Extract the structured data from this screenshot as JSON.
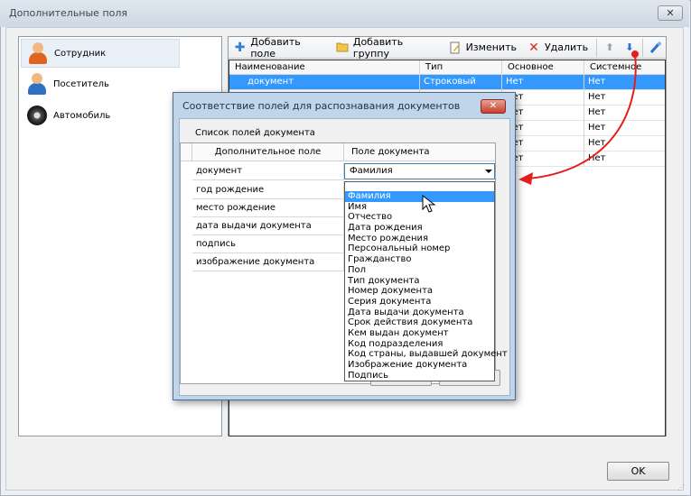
{
  "window": {
    "title": "Дополнительные поля",
    "close_glyph": "✕"
  },
  "left_panel": {
    "items": [
      {
        "label": "Сотрудник",
        "icon": "employee-icon",
        "selected": true
      },
      {
        "label": "Посетитель",
        "icon": "visitor-icon",
        "selected": false
      },
      {
        "label": "Автомобиль",
        "icon": "car-wheel-icon",
        "selected": false
      }
    ]
  },
  "toolbar": {
    "add_field": "Добавить поле",
    "add_group": "Добавить группу",
    "edit": "Изменить",
    "delete": "Удалить"
  },
  "grid": {
    "columns": [
      "Наименование",
      "Тип",
      "Основное",
      "Системное"
    ],
    "rows": [
      [
        "документ",
        "Строковый",
        "Нет",
        "Нет"
      ],
      [
        "",
        "",
        "Нет",
        "Нет"
      ],
      [
        "",
        "",
        "Нет",
        "Нет"
      ],
      [
        "",
        "",
        "Нет",
        "Нет"
      ],
      [
        "",
        "",
        "Нет",
        "Нет"
      ],
      [
        "",
        "",
        "Нет",
        "Нет"
      ]
    ]
  },
  "ok_button": "OK",
  "dialog": {
    "title": "Соответствие полей для распознавания документов",
    "close_glyph": "✕",
    "caption": "Список полей документа",
    "columns": [
      "Дополнительное поле",
      "Поле документа"
    ],
    "rows": [
      "документ",
      "год рождение",
      "место рождение",
      "дата выдачи документа",
      "подпись",
      "изображение документа"
    ],
    "combo_value": "Фамилия",
    "dropdown_options": [
      "Фамилия",
      "Имя",
      "Отчество",
      "Дата рождения",
      "Место рождения",
      "Персональный номер",
      "Гражданство",
      "Пол",
      "Тип документа",
      "Номер документа",
      "Серия документа",
      "Дата выдачи документа",
      "Срок действия документа",
      "Кем выдан документ",
      "Код подразделения",
      "Код страны, выдавшей документ",
      "Изображение документа",
      "Подпись"
    ]
  },
  "colors": {
    "selection": "#3399ff",
    "annotation_arrow": "#e0201e",
    "dialog_frame": "#c1d5ea"
  }
}
